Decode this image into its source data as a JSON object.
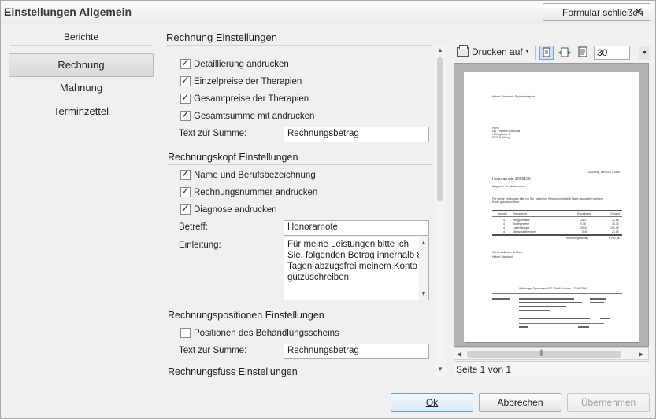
{
  "window": {
    "title": "Einstellungen Allgemein",
    "close_form_button": "Formular schließen"
  },
  "nav": {
    "header": "Berichte",
    "items": [
      "Rechnung",
      "Mahnung",
      "Terminzettel"
    ],
    "selected": "Rechnung"
  },
  "settings": {
    "rechnung": {
      "title": "Rechnung Einstellungen",
      "checkboxes": [
        {
          "label": "Detaillierung andrucken",
          "checked": true
        },
        {
          "label": "Einzelpreise der Therapien",
          "checked": true
        },
        {
          "label": "Gesamtpreise der Therapien",
          "checked": true
        },
        {
          "label": "Gesamtsumme mit andrucken",
          "checked": true
        }
      ],
      "sum_label": "Text zur Summe:",
      "sum_value": "Rechnungsbetrag"
    },
    "kopf": {
      "title": "Rechnungskopf Einstellungen",
      "checkboxes": [
        {
          "label": "Name und Berufsbezeichnung",
          "checked": true
        },
        {
          "label": "Rechnungsnummer andrucken",
          "checked": true
        },
        {
          "label": "Diagnose andrucken",
          "checked": true
        }
      ],
      "betreff_label": "Betreff:",
      "betreff_value": "Honorarnote",
      "einleitung_label": "Einleitung:",
      "einleitung_value": "Für meine Leistungen bitte ich\nSie, folgenden Betrag innerhalb 8\nTagen abzugsfrei meinem Konto\ngutzuschreiben:"
    },
    "positionen": {
      "title": "Rechnungspositionen Einstellungen",
      "checkboxes": [
        {
          "label": "Positionen des Behandlungsscheins",
          "checked": false
        }
      ],
      "sum_label": "Text zur Summe:",
      "sum_value": "Rechnungsbetrag"
    },
    "fuss": {
      "title": "Rechnungsfuss Einstellungen"
    }
  },
  "preview": {
    "print_label": "Drucken auf",
    "zoom": "30",
    "status": "Seite 1 von 1",
    "page": {
      "sender": "Hubert Standard · Physiotherapeut",
      "recipient": [
        "Herrn",
        "Ing. Friedrich Dreshval",
        "Hinterglasse 1",
        "5020 Salzburg"
      ],
      "date": "Salzburg, den 01.07.1999",
      "heading": "Honorarnote 2005166",
      "diagnosis": "Diagnose: Zervikalsyndrom",
      "intro": "Für meine Leistungen bitte ich Sie, folgenden Betrag innerhalb 8 Tagen abzugsfrei meinem Konto gutzuschreiben:",
      "table_headers": [
        "Anzahl",
        "Therapieart",
        "Einzelpreis",
        "Gesamt"
      ],
      "rows": [
        [
          "4",
          "Heilgymnastik",
          "18,17",
          "72,68"
        ],
        [
          "4",
          "Bindegewebe",
          "9,08",
          "36,34"
        ],
        [
          "4",
          "Lasertherapie",
          "25,44",
          "101,76"
        ],
        [
          "4",
          "Ultraschalltherapie",
          "5,45",
          "21,80"
        ]
      ],
      "total_label": "Rechnungsbetrag",
      "total": "€ 232,58",
      "closing": "Mit freundlichen Grüßen",
      "signature": "Hubert Standard",
      "bank": "Salzburger Sparkasse BLZ 20404 Kontonr. 1234567890"
    }
  },
  "buttons": {
    "ok": "Ok",
    "cancel": "Abbrechen",
    "apply": "Übernehmen"
  },
  "colors": {
    "window_bg": "#f0f0f0",
    "default_button_border": "#6aa0d8",
    "preview_bg": "#b1b1b1"
  },
  "icons": [
    "close-icon",
    "printer-icon",
    "single-page-icon",
    "fit-width-icon",
    "page-view-icon",
    "dropdown-arrow-icon"
  ]
}
